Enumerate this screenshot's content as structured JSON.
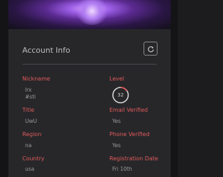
{
  "card": {
    "title": "Account Info"
  },
  "fields": {
    "nickname_label": "Nickname",
    "nickname_line1": "lrx",
    "nickname_line2": "#sti",
    "title_label": "Title",
    "title_value": "UwU",
    "region_label": "Region",
    "region_value": "na",
    "country_label": "Country",
    "country_value": "usa",
    "level_label": "Level",
    "level_value": "32",
    "email_label": "Email Verified",
    "email_value": "Yes",
    "phone_label": "Phone Verified",
    "phone_value": "Yes",
    "reg_label": "Registration Date",
    "reg_value": "Fri 10th"
  },
  "icons": {
    "refresh": "refresh-icon"
  },
  "colors": {
    "label": "#e05a5a",
    "ring_accent": "#e05a5a"
  }
}
